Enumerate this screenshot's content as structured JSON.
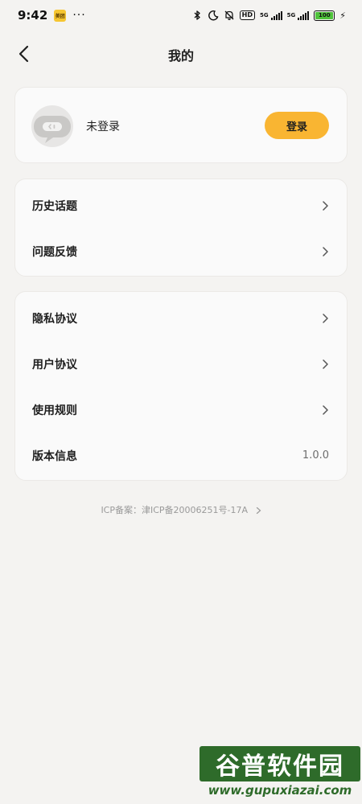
{
  "status_bar": {
    "time": "9:42",
    "app_badge": "美团",
    "dots": "···",
    "hd": "HD",
    "net1": "5G",
    "net2": "5G",
    "battery": "100"
  },
  "header": {
    "title": "我的"
  },
  "user": {
    "status": "未登录",
    "login_label": "登录"
  },
  "menu_group_1": [
    {
      "label": "历史话题"
    },
    {
      "label": "问题反馈"
    }
  ],
  "menu_group_2": [
    {
      "label": "隐私协议"
    },
    {
      "label": "用户协议"
    },
    {
      "label": "使用规则"
    },
    {
      "label": "版本信息",
      "value": "1.0.0"
    }
  ],
  "icp": {
    "text": "ICP备案：津ICP备20006251号-17A"
  },
  "watermark": {
    "title": "谷普软件园",
    "url": "www.gupuxiazai.com"
  },
  "colors": {
    "accent": "#f9b532",
    "background": "#f4f3f1",
    "card": "#fafafa"
  }
}
